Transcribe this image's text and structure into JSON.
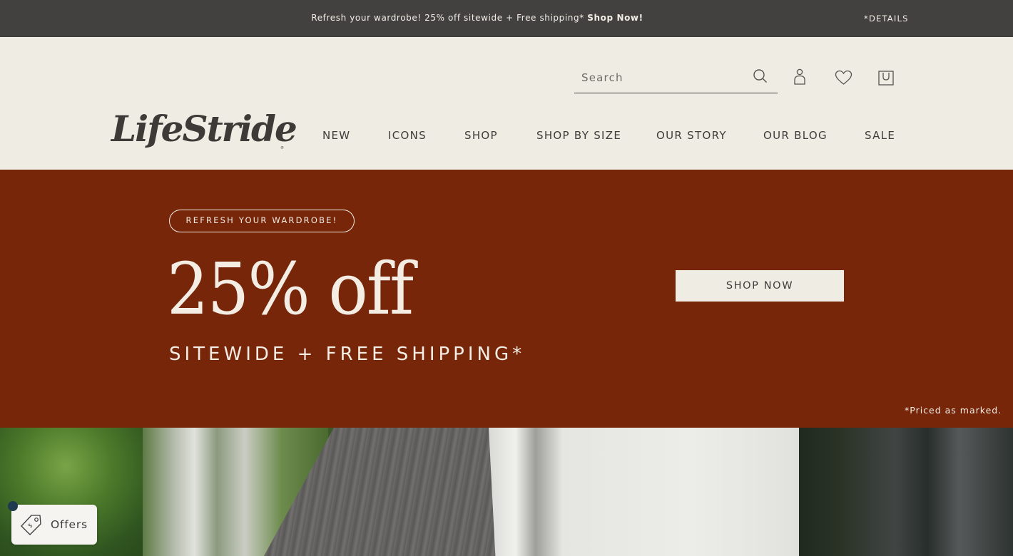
{
  "promo_bar": {
    "message": "Refresh your wardrobe! 25% off sitewide + Free shipping*",
    "cta": "Shop Now!",
    "details_link": "*DETAILS"
  },
  "header": {
    "brand": "LifeStride",
    "brand_mark": "®",
    "search": {
      "placeholder": "Search",
      "value": ""
    },
    "icons": [
      "search-icon",
      "account-icon",
      "wishlist-heart-icon",
      "shopping-bag-icon"
    ],
    "nav": [
      {
        "label": "NEW"
      },
      {
        "label": "ICONS"
      },
      {
        "label": "SHOP"
      },
      {
        "label": "SHOP BY SIZE"
      },
      {
        "label": "OUR STORY"
      },
      {
        "label": "OUR BLOG"
      },
      {
        "label": "SALE"
      }
    ]
  },
  "hero": {
    "pill": "REFRESH YOUR WARDROBE!",
    "headline": "25% off",
    "subheadline": "SITEWIDE + FREE SHIPPING*",
    "cta": "SHOP NOW",
    "disclaimer": "*Priced as marked.",
    "background_color": "#78260a"
  },
  "offers_widget": {
    "label": "Offers",
    "icon": "price-tag-icon"
  }
}
